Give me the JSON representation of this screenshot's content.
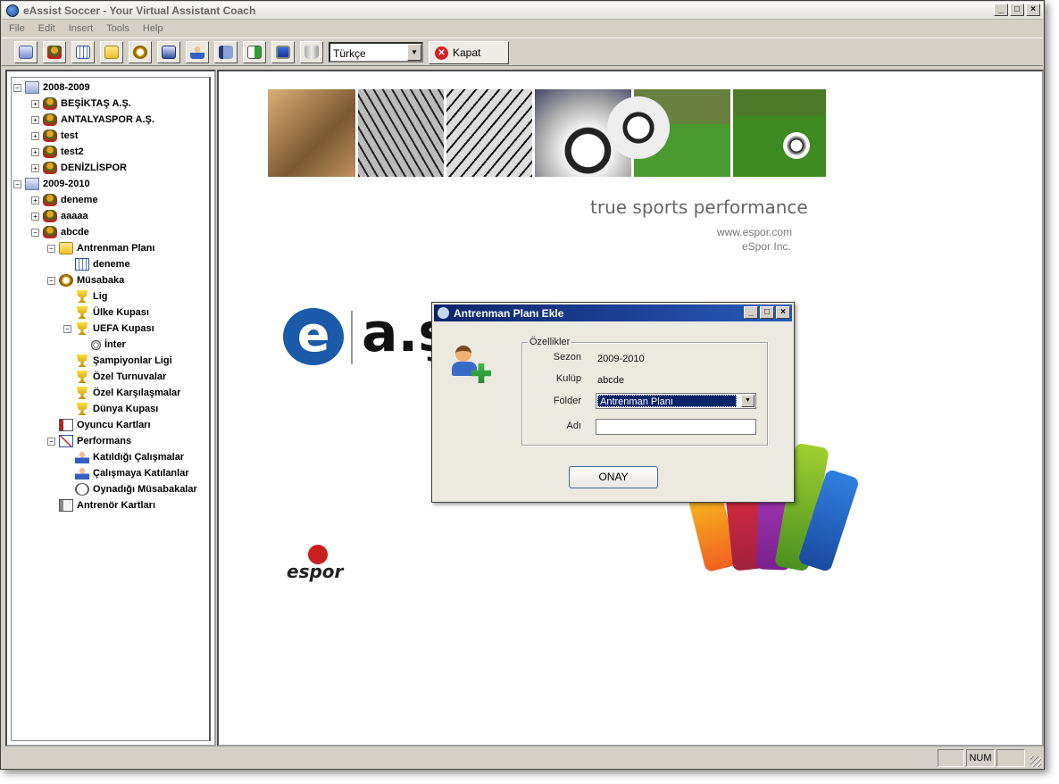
{
  "window": {
    "title": "eAssist Soccer - Your Virtual Assistant Coach"
  },
  "menu": [
    "File",
    "Edit",
    "Insert",
    "Tools",
    "Help"
  ],
  "toolbar": {
    "language": "Türkçe",
    "close_label": "Kapat",
    "icons": [
      "calendar-check-icon",
      "club-icon",
      "grid-calendar-icon",
      "folder-icon",
      "stopwatch-icon",
      "schedule-icon",
      "player-icon",
      "notebook-icon",
      "export-icon",
      "monitor-icon",
      "trash-icon"
    ]
  },
  "tree": {
    "nodes": [
      {
        "label": "2008-2009",
        "icon": "season-icon",
        "level": 0,
        "exp": "-"
      },
      {
        "label": "BEŞİKTAŞ A.Ş.",
        "icon": "club-icon",
        "level": 1,
        "exp": "+"
      },
      {
        "label": "ANTALYASPOR A.Ş.",
        "icon": "club-icon",
        "level": 1,
        "exp": "+"
      },
      {
        "label": "test",
        "icon": "club-icon",
        "level": 1,
        "exp": "+"
      },
      {
        "label": "test2",
        "icon": "club-icon",
        "level": 1,
        "exp": "+"
      },
      {
        "label": "DENİZLİSPOR",
        "icon": "club-icon",
        "level": 1,
        "exp": "+"
      },
      {
        "label": "2009-2010",
        "icon": "season-icon",
        "level": 0,
        "exp": "-"
      },
      {
        "label": "deneme",
        "icon": "club-icon",
        "level": 1,
        "exp": "+"
      },
      {
        "label": "aaaaa",
        "icon": "club-icon",
        "level": 1,
        "exp": "+"
      },
      {
        "label": "abcde",
        "icon": "club-icon",
        "level": 1,
        "exp": "-"
      },
      {
        "label": "Antrenman Planı",
        "icon": "folder-icon",
        "level": 2,
        "exp": "-"
      },
      {
        "label": "deneme",
        "icon": "grid-icon",
        "level": 3,
        "exp": ""
      },
      {
        "label": "Müsabaka",
        "icon": "stopwatch-icon",
        "level": 2,
        "exp": "-"
      },
      {
        "label": "Lig",
        "icon": "trophy-icon",
        "level": 3,
        "exp": ""
      },
      {
        "label": "Ülke Kupası",
        "icon": "trophy-icon",
        "level": 3,
        "exp": ""
      },
      {
        "label": "UEFA Kupası",
        "icon": "trophy-icon",
        "level": 3,
        "exp": "-"
      },
      {
        "label": "İnter",
        "icon": "ball-icon",
        "level": 4,
        "exp": ""
      },
      {
        "label": "Şampiyonlar Ligi",
        "icon": "trophy-icon",
        "level": 3,
        "exp": ""
      },
      {
        "label": "Özel Turnuvalar",
        "icon": "trophy-icon",
        "level": 3,
        "exp": ""
      },
      {
        "label": "Özel Karşılaşmalar",
        "icon": "trophy-icon",
        "level": 3,
        "exp": ""
      },
      {
        "label": "Dünya Kupası",
        "icon": "trophy-icon",
        "level": 3,
        "exp": ""
      },
      {
        "label": "Oyuncu Kartları",
        "icon": "card-icon",
        "level": 2,
        "exp": ""
      },
      {
        "label": "Performans",
        "icon": "chart-icon",
        "level": 2,
        "exp": "-"
      },
      {
        "label": "Katıldığı Çalışmalar",
        "icon": "person-icon",
        "level": 3,
        "exp": ""
      },
      {
        "label": "Çalışmaya Katılanlar",
        "icon": "person-icon",
        "level": 3,
        "exp": ""
      },
      {
        "label": "Oynadığı Müsabakalar",
        "icon": "clock-icon",
        "level": 3,
        "exp": ""
      },
      {
        "label": "Antrenör Kartları",
        "icon": "coachcard-icon",
        "level": 2,
        "exp": ""
      }
    ]
  },
  "splash": {
    "tagline": "true sports performance",
    "website": "www.espor.com",
    "company": "eSpor Inc.",
    "logo_mark": "e",
    "logo_text": "a.ş",
    "espor_text": "espor"
  },
  "dialog": {
    "title": "Antrenman Planı Ekle",
    "group_label": "Özellikler",
    "sezon_label": "Sezon",
    "sezon_value": "2009-2010",
    "kulup_label": "Kulüp",
    "kulup_value": "abcde",
    "folder_label": "Folder",
    "folder_value": "Antrenman Planı",
    "adi_label": "Adı",
    "adi_value": "",
    "confirm_label": "ONAY"
  },
  "status": {
    "num": "NUM"
  },
  "colors": {
    "dialog_title": "#0a246a",
    "accent_red": "#d52020"
  }
}
